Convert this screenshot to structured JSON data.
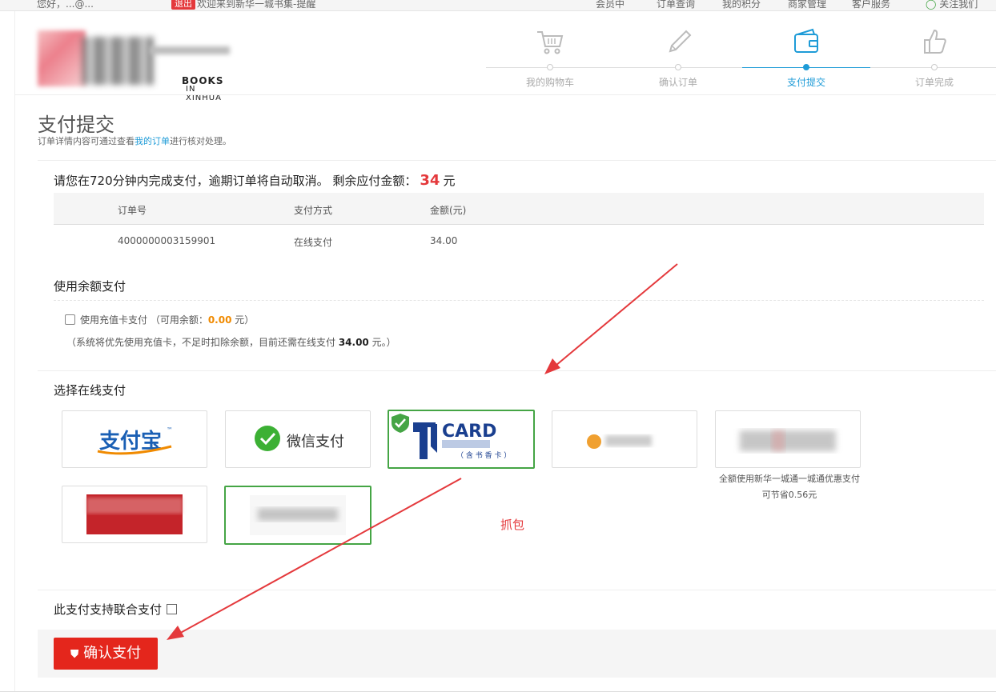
{
  "topbar": {
    "greeting": "您好，",
    "email": "...@...",
    "tag": "退出",
    "welcome": "欢迎来到新华一城书集-提醒",
    "links": [
      "会员中",
      "订单查询",
      "我的积分",
      "商家管理",
      "客户服务"
    ],
    "follow": "关注我们"
  },
  "logo": {
    "books": "BOOKS",
    "sub": "IN XINHUA"
  },
  "steps": [
    {
      "label": "我的购物车",
      "icon": "cart-icon",
      "active": false
    },
    {
      "label": "确认订单",
      "icon": "pen-icon",
      "active": false
    },
    {
      "label": "支付提交",
      "icon": "wallet-icon",
      "active": true
    },
    {
      "label": "订单完成",
      "icon": "thumbs-up-icon",
      "active": false
    }
  ],
  "page": {
    "title": "支付提交",
    "sub_prefix": "订单详情内容可通过查看",
    "sub_link": "我的订单",
    "sub_suffix": "进行核对处理。"
  },
  "notice": {
    "text": "请您在720分钟内完成支付，逾期订单将自动取消。 剩余应付金额：",
    "amount": "34",
    "unit": "元"
  },
  "order_table": {
    "headers": [
      "订单号",
      "支付方式",
      "金额(元)"
    ],
    "rows": [
      [
        "4000000003159901",
        "在线支付",
        "34.00"
      ]
    ]
  },
  "balance": {
    "title": "使用余额支付",
    "checkbox_label": "使用充值卡支付  （可用余额：",
    "available": "0.00",
    "available_suffix": " 元）",
    "note_prefix": "（系统将优先使用充值卡，不足时扣除余额，目前还需在线支付 ",
    "note_amount": "34.00",
    "note_suffix": " 元。）"
  },
  "online": {
    "title": "选择在线支付",
    "alipay": "支付宝",
    "wechat": "微信支付",
    "card_main": "CARD",
    "card_sub": "（ 含 书 香 卡 ）",
    "promo": "全额使用新华一城通一城通优惠支付可节省0.56元"
  },
  "annotation": "抓包",
  "combine": {
    "label": "此支付支持联合支付"
  },
  "confirm": {
    "label": "确认支付"
  },
  "colors": {
    "accent": "#1e9bd7",
    "danger": "#e4261c",
    "selected": "#45a545",
    "orange": "#f08a00"
  }
}
